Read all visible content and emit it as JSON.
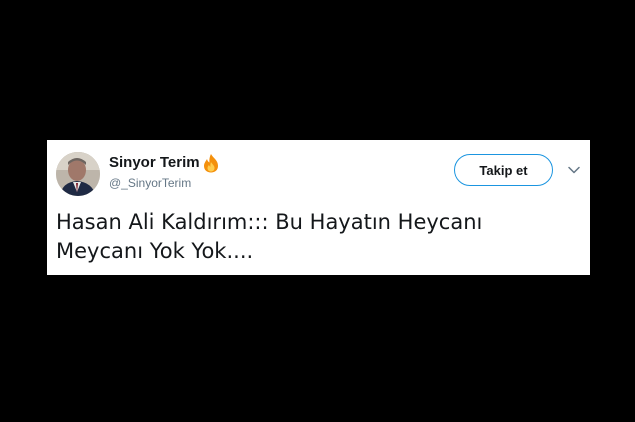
{
  "tweet": {
    "display_name": "Sinyor Terim",
    "handle": "@_SinyorTerim",
    "follow_label": "Takip et",
    "text_line1": "Hasan Ali Kaldırım::: Bu Hayatın Heycanı",
    "text_line2": "Meycanı Yok Yok....",
    "name_emoji_icon": "fire-icon",
    "menu_icon": "chevron-down-icon"
  },
  "colors": {
    "background": "#000000",
    "card": "#ffffff",
    "text": "#14171a",
    "muted": "#657786",
    "accent": "#1b95e0"
  }
}
